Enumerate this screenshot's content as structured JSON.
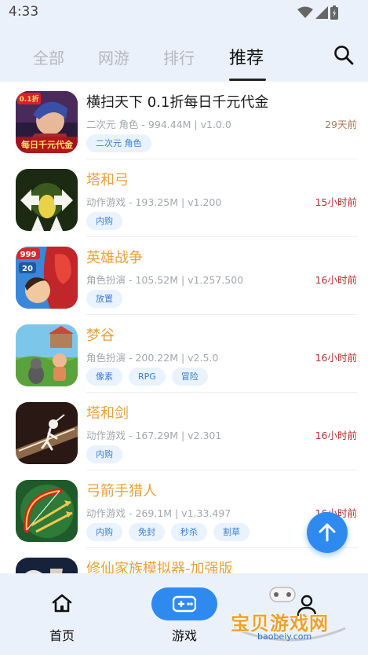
{
  "status_bar": {
    "time": "4:33"
  },
  "tabs": [
    {
      "label": "全部"
    },
    {
      "label": "网游"
    },
    {
      "label": "排行"
    },
    {
      "label": "推荐"
    }
  ],
  "games": [
    {
      "name": "横扫天下 0.1折每日千元代金",
      "meta": "二次元 角色 - 994.44M | v1.0.0",
      "time": "29天前",
      "tags": [
        "二次元 角色"
      ],
      "icon_badge": "0.1折",
      "icon_caption": "每日千元代金"
    },
    {
      "name": "塔和弓",
      "meta": "动作游戏 - 193.25M | v1.200",
      "time": "15小时前",
      "tags": [
        "内购"
      ]
    },
    {
      "name": "英雄战争",
      "meta": "角色扮演 - 105.52M | v1.257.500",
      "time": "16小时前",
      "tags": [
        "放置"
      ],
      "icon_badge": "999",
      "icon_sub": "20"
    },
    {
      "name": "梦谷",
      "meta": "角色扮演 - 200.22M | v2.5.0",
      "time": "16小时前",
      "tags": [
        "像素",
        "RPG",
        "冒险"
      ]
    },
    {
      "name": "塔和剑",
      "meta": "动作游戏 - 167.29M | v2.301",
      "time": "16小时前",
      "tags": [
        "内购"
      ]
    },
    {
      "name": "弓箭手猎人",
      "meta": "动作游戏 - 269.1M | v1.33.497",
      "time": "16小时前",
      "tags": [
        "内购",
        "免封",
        "秒杀",
        "割草"
      ]
    },
    {
      "name": "修仙家族模拟器-加强版",
      "meta": "",
      "time": "",
      "tags": []
    }
  ],
  "bottom_nav": {
    "home_label": "首页",
    "games_label": "游戏"
  },
  "watermark": {
    "text": "宝贝游戏网",
    "url": "baobeiy.com"
  },
  "colors": {
    "accent": "#2f8af0",
    "title_highlight": "#e8a13a",
    "time_red": "#b63030",
    "tag_bg": "#e9f2fd",
    "tag_text": "#3c7fcf"
  },
  "icons": [
    "wifi-icon",
    "signal-icon",
    "battery-icon",
    "search-icon",
    "arrow-up-icon",
    "home-icon",
    "gamepad-icon",
    "user-icon"
  ]
}
